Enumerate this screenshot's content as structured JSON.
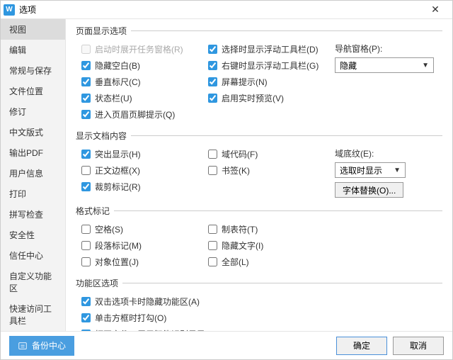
{
  "title": "选项",
  "sidebar": {
    "items": [
      {
        "label": "视图"
      },
      {
        "label": "编辑"
      },
      {
        "label": "常规与保存"
      },
      {
        "label": "文件位置"
      },
      {
        "label": "修订"
      },
      {
        "label": "中文版式"
      },
      {
        "label": "输出PDF"
      },
      {
        "label": "用户信息"
      },
      {
        "label": "打印"
      },
      {
        "label": "拼写检查"
      },
      {
        "label": "安全性"
      },
      {
        "label": "信任中心"
      },
      {
        "label": "自定义功能区"
      },
      {
        "label": "快速访问工具栏"
      }
    ]
  },
  "groups": {
    "pageDisplay": {
      "legend": "页面显示选项",
      "col1": {
        "startUnfoldTask": "启动时展开任务窗格(R)",
        "hideWhitespace": "隐藏空白(B)",
        "verticalRuler": "垂直标尺(C)",
        "statusBar": "状态栏(U)",
        "headerFooterHint": "进入页眉页脚提示(Q)"
      },
      "col2": {
        "selectionFloatToolbar": "选择时显示浮动工具栏(D)",
        "rightClickFloatToolbar": "右键时显示浮动工具栏(G)",
        "screenTip": "屏幕提示(N)",
        "livePreview": "启用实时预览(V)"
      },
      "col3": {
        "navPaneLabel": "导航窗格(P):",
        "navPaneValue": "隐藏"
      }
    },
    "docContent": {
      "legend": "显示文档内容",
      "col1": {
        "highlight": "突出显示(H)",
        "textBoundary": "正文边框(X)",
        "cropMark": "裁剪标记(R)"
      },
      "col2": {
        "fieldCode": "域代码(F)",
        "bookmark": "书签(K)"
      },
      "col3": {
        "shadingLabel": "域底纹(E):",
        "shadingValue": "选取时显示",
        "fontSubBtn": "字体替换(O)..."
      }
    },
    "formatMarks": {
      "legend": "格式标记",
      "col1": {
        "space": "空格(S)",
        "paragraph": "段落标记(M)",
        "objAnchor": "对象位置(J)"
      },
      "col2": {
        "tab": "制表符(T)",
        "hiddenText": "隐藏文字(I)",
        "all": "全部(L)"
      }
    },
    "ribbon": {
      "legend": "功能区选项",
      "dblClickHide": "双击选项卡时隐藏功能区(A)",
      "clickCheck": "单击方框时打勾(O)",
      "openShowNav": "打开文件，展示智能识别目录(W)"
    }
  },
  "footer": {
    "backup": "备份中心",
    "ok": "确定",
    "cancel": "取消"
  }
}
